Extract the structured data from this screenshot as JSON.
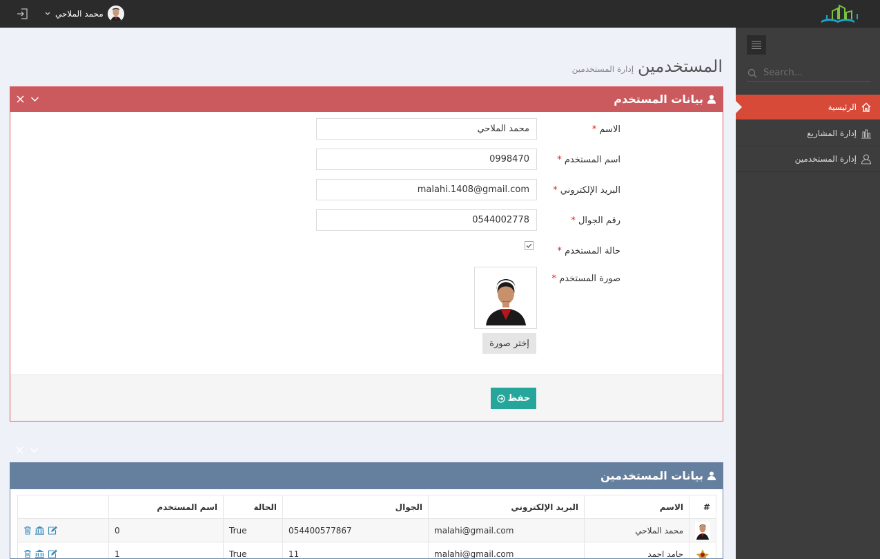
{
  "topbar": {
    "user_name": "محمد الملاحي"
  },
  "sidebar": {
    "search_placeholder": "Search...",
    "items": [
      {
        "label": "الرئيسية",
        "icon": "home-icon",
        "active": true
      },
      {
        "label": "إدارة المشاريع",
        "icon": "bar-chart-icon",
        "active": false
      },
      {
        "label": "إدارة المستخدمين",
        "icon": "user-icon",
        "active": false
      }
    ]
  },
  "page": {
    "title": "المستخدمين",
    "subtitle": "إدارة المستخدمين"
  },
  "form_portlet": {
    "title": "بيانات المستخدم",
    "fields": {
      "name": {
        "label": "الاسم",
        "value": "محمد الملاحي"
      },
      "username": {
        "label": "اسم المستخدم",
        "value": "0998470"
      },
      "email": {
        "label": "البريد الإلكتروني",
        "value": "malahi.1408@gmail.com"
      },
      "mobile": {
        "label": "رقم الجوال",
        "value": "0544002778"
      },
      "status": {
        "label": "حالة المستخدم",
        "checked": true
      },
      "photo": {
        "label": "صورة المستخدم"
      }
    },
    "required_mark": "*",
    "choose_photo_label": "إختر صورة",
    "save_label": "حفظ"
  },
  "table_portlet": {
    "title": "بيانات المستخدمين",
    "columns": [
      "#",
      "الاسم",
      "البريد الإلكتروني",
      "الجوال",
      "الحالة",
      "اسم المستخدم",
      ""
    ],
    "rows": [
      {
        "name": "محمد الملاحي",
        "email": "malahi@gmail.com",
        "mobile": "054400577867",
        "status": "True",
        "username": "0"
      },
      {
        "name": "حامد احمد",
        "email": "malahi@gmail.com",
        "mobile": "11",
        "status": "True",
        "username": "1"
      }
    ]
  },
  "colors": {
    "topbar": "#2b2b2b",
    "sidebar": "#3d3d3d",
    "active_item": "#d84a38",
    "red_portlet": "#cb5a5e",
    "blue_portlet": "#657f9e",
    "save_button": "#26a69a"
  }
}
